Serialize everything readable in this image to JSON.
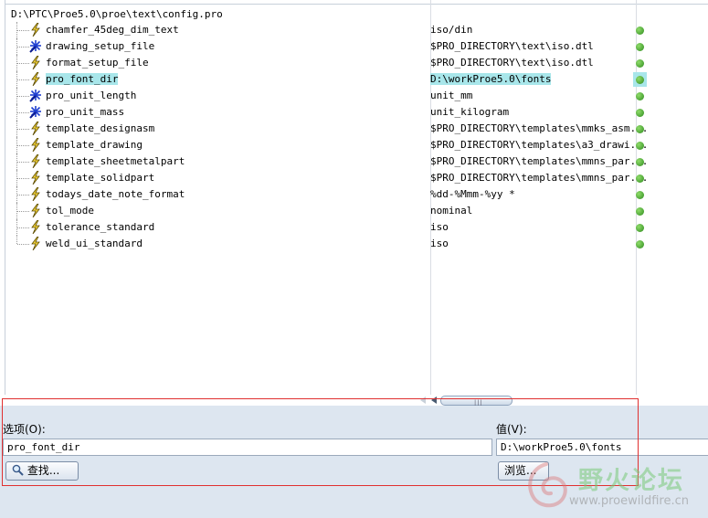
{
  "tree": {
    "root_path": "D:\\PTC\\Proe5.0\\proe\\text\\config.pro",
    "rows": [
      {
        "name": "chamfer_45deg_dim_text",
        "value": "iso/din",
        "icon": "lightning-icon"
      },
      {
        "name": "drawing_setup_file",
        "value": "$PRO_DIRECTORY\\text\\iso.dtl",
        "icon": "star-burst-icon"
      },
      {
        "name": "format_setup_file",
        "value": "$PRO_DIRECTORY\\text\\iso.dtl",
        "icon": "lightning-icon"
      },
      {
        "name": "pro_font_dir",
        "value": "D:\\workProe5.0\\fonts",
        "icon": "lightning-icon"
      },
      {
        "name": "pro_unit_length",
        "value": "unit_mm",
        "icon": "star-burst-icon"
      },
      {
        "name": "pro_unit_mass",
        "value": "unit_kilogram",
        "icon": "star-burst-icon"
      },
      {
        "name": "template_designasm",
        "value": "$PRO_DIRECTORY\\templates\\mmks_asm...",
        "icon": "lightning-icon"
      },
      {
        "name": "template_drawing",
        "value": "$PRO_DIRECTORY\\templates\\a3_drawi...",
        "icon": "lightning-icon"
      },
      {
        "name": "template_sheetmetalpart",
        "value": "$PRO_DIRECTORY\\templates\\mmns_par...",
        "icon": "lightning-icon"
      },
      {
        "name": "template_solidpart",
        "value": "$PRO_DIRECTORY\\templates\\mmns_par...",
        "icon": "lightning-icon"
      },
      {
        "name": "todays_date_note_format",
        "value": "%dd-%Mmm-%yy *",
        "icon": "lightning-icon"
      },
      {
        "name": "tol_mode",
        "value": "nominal",
        "icon": "lightning-icon"
      },
      {
        "name": "tolerance_standard",
        "value": "iso",
        "icon": "lightning-icon"
      },
      {
        "name": "weld_ui_standard",
        "value": "iso",
        "icon": "lightning-icon"
      }
    ],
    "selected_index": 3
  },
  "scrollbar": {
    "grip": "|||"
  },
  "form": {
    "option_label": "选项(O):",
    "value_label": "值(V):",
    "option_value": "pro_font_dir",
    "value_value": "D:\\workProe5.0\\fonts",
    "find_button": "查找...",
    "browse_button": "浏览..."
  },
  "watermark": {
    "name": "野火论坛",
    "url": "www.proewildfire.cn"
  },
  "colors": {
    "selection": "#a8e6ea",
    "status_dot": "#2e8b1e",
    "annotation_box": "#e03030",
    "panel_bg": "#dde6f0"
  }
}
